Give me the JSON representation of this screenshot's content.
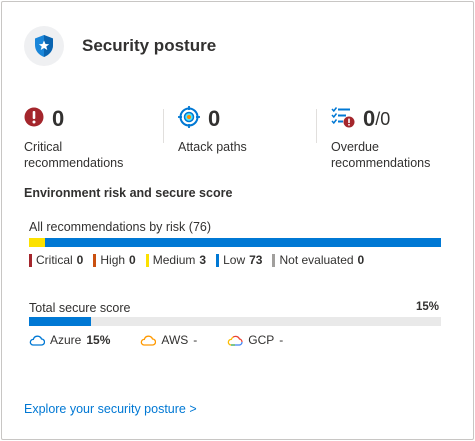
{
  "card": {
    "title": "Security posture",
    "header_icon": "shield-star-icon"
  },
  "metrics": [
    {
      "value": "0",
      "label": "Critical recommendations",
      "icon": "critical-alert-icon"
    },
    {
      "value": "0",
      "label": "Attack paths",
      "icon": "attack-path-icon"
    },
    {
      "value": "0",
      "denominator": "/0",
      "label": "Overdue recommendations",
      "icon": "overdue-list-icon"
    }
  ],
  "section_title": "Environment risk and secure score",
  "risk": {
    "label": "All recommendations by risk (76)",
    "total": 76,
    "legend": [
      {
        "name": "Critical",
        "count": "0",
        "color": "#a4262c"
      },
      {
        "name": "High",
        "count": "0",
        "color": "#ca5010"
      },
      {
        "name": "Medium",
        "count": "3",
        "color": "#fce100"
      },
      {
        "name": "Low",
        "count": "73",
        "color": "#0078d4"
      },
      {
        "name": "Not evaluated",
        "count": "0",
        "color": "#a19f9d"
      }
    ]
  },
  "secure_score": {
    "label": "Total secure score",
    "percent_text": "15%",
    "percent": 15,
    "bar_color": "#0078d4"
  },
  "clouds": [
    {
      "name": "Azure",
      "value": "15%",
      "icon": "azure-cloud-icon",
      "color": "#0078d4"
    },
    {
      "name": "AWS",
      "value": "-",
      "icon": "aws-cloud-icon",
      "color": "#ff9900"
    },
    {
      "name": "GCP",
      "value": "-",
      "icon": "gcp-cloud-icon",
      "color": "#34a853"
    }
  ],
  "explore_link": "Explore your security posture >"
}
